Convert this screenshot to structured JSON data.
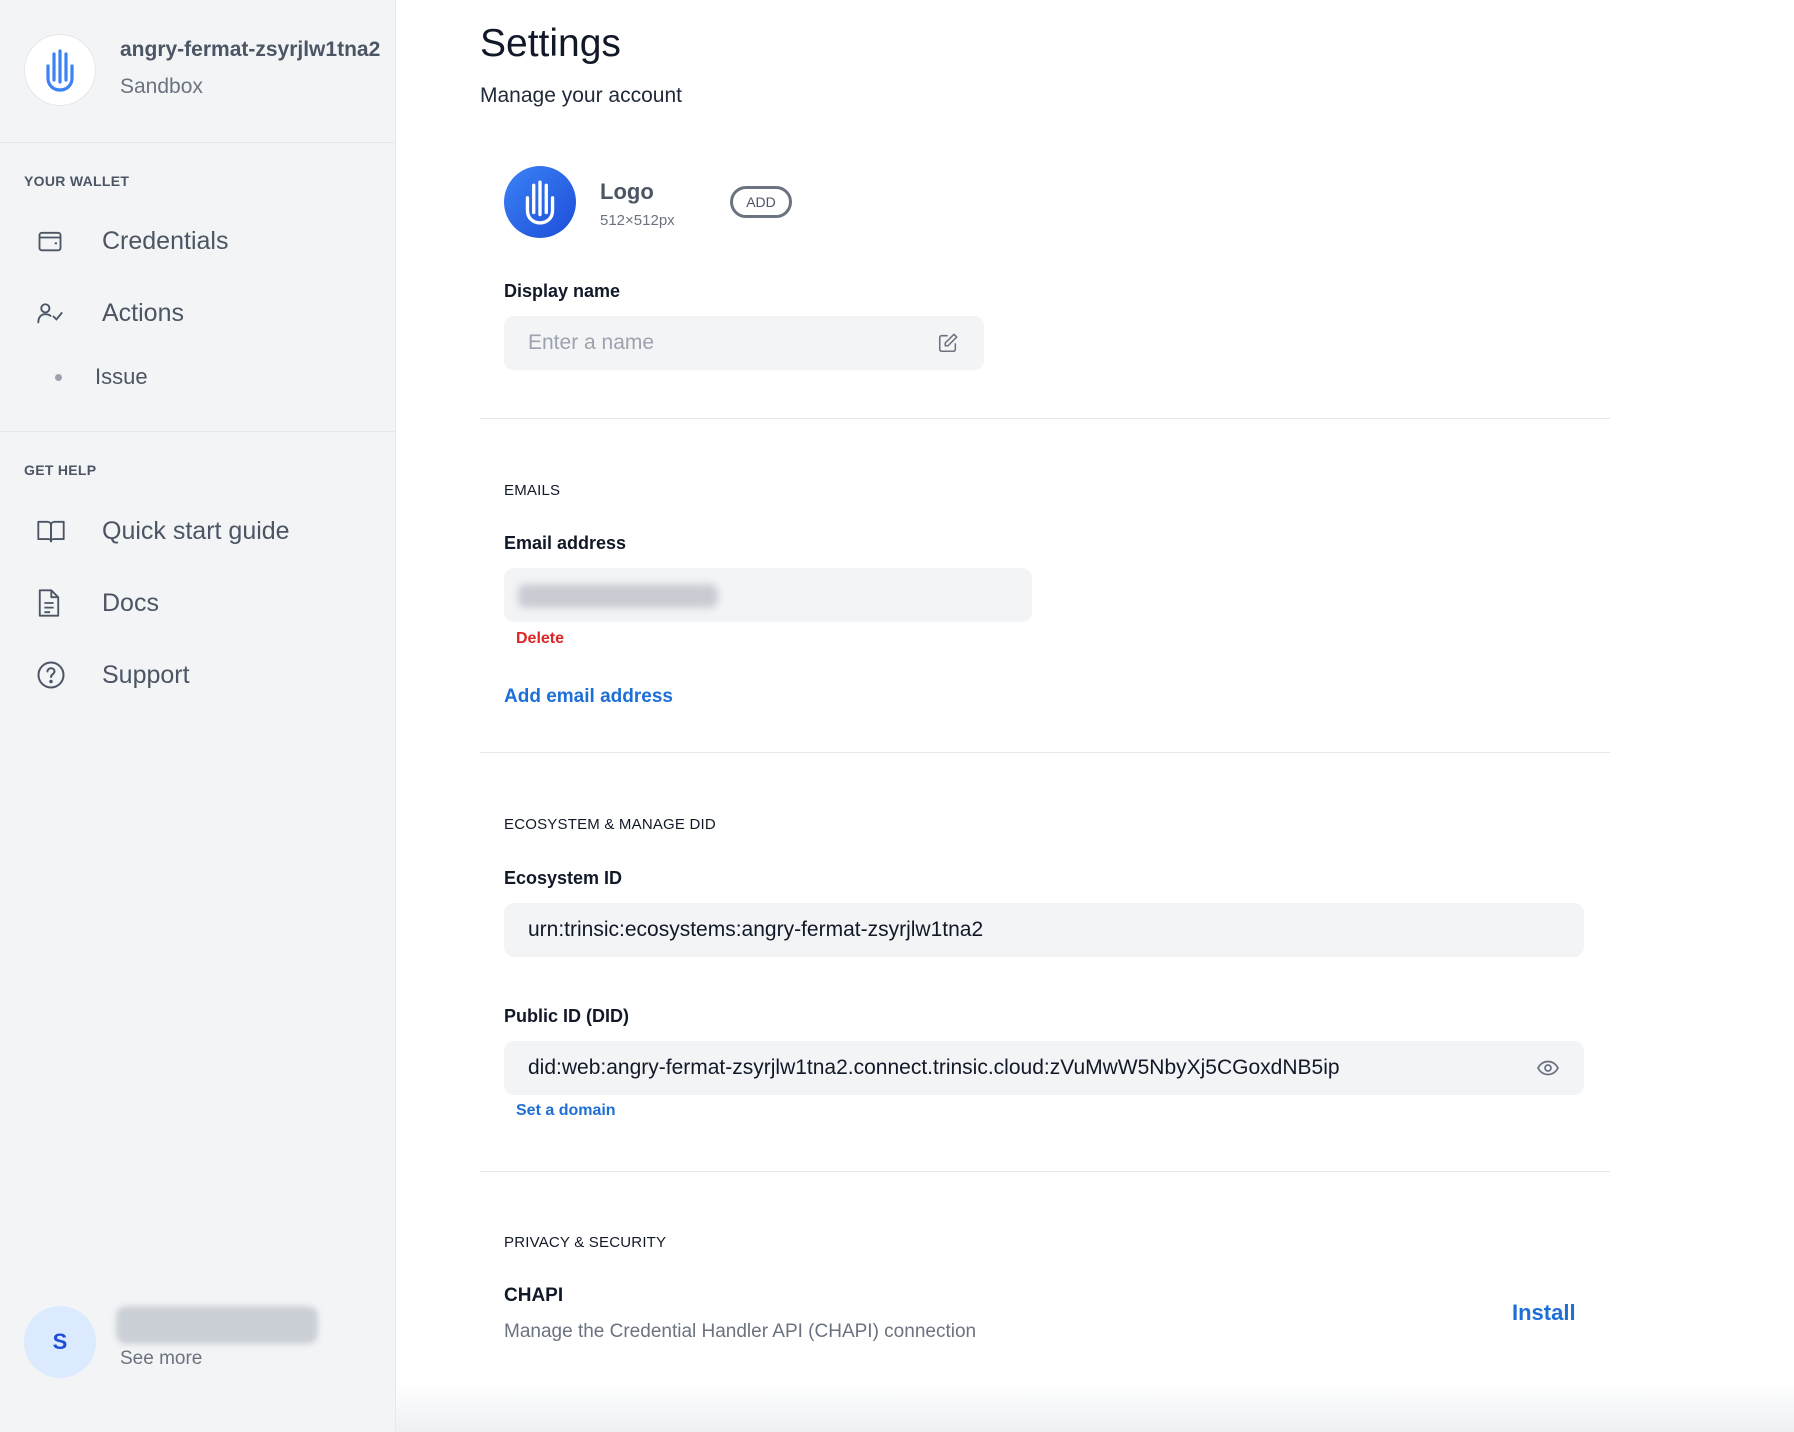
{
  "org": {
    "name": "angry-fermat-zsyrjlw1tna2",
    "environment": "Sandbox",
    "logo_icon": "trinsic-hand-icon"
  },
  "sidebar": {
    "wallet_label": "YOUR WALLET",
    "help_label": "GET HELP",
    "items": [
      {
        "label": "Credentials",
        "icon": "wallet-icon"
      },
      {
        "label": "Actions",
        "icon": "user-check-icon"
      },
      {
        "label": "Issue",
        "icon": "dot-icon"
      },
      {
        "label": "Quick start guide",
        "icon": "book-icon"
      },
      {
        "label": "Docs",
        "icon": "document-icon"
      },
      {
        "label": "Support",
        "icon": "question-circle-icon"
      }
    ]
  },
  "user": {
    "initial": "S",
    "see_more": "See more"
  },
  "page": {
    "title": "Settings",
    "subtitle": "Manage your account"
  },
  "logo": {
    "title": "Logo",
    "size": "512×512px",
    "add_label": "ADD"
  },
  "display_name": {
    "label": "Display name",
    "placeholder": "Enter a name"
  },
  "emails": {
    "section": "EMAILS",
    "label": "Email address",
    "delete_label": "Delete",
    "add_label": "Add email address"
  },
  "ecosystem": {
    "section": "ECOSYSTEM & MANAGE DID",
    "id_label": "Ecosystem ID",
    "id_value": "urn:trinsic:ecosystems:angry-fermat-zsyrjlw1tna2",
    "did_label": "Public ID (DID)",
    "did_value": "did:web:angry-fermat-zsyrjlw1tna2.connect.trinsic.cloud:zVuMwW5NbyXj5CGoxdNB5ip",
    "set_domain": "Set a domain"
  },
  "privacy": {
    "section": "PRIVACY & SECURITY",
    "chapi_title": "CHAPI",
    "chapi_desc": "Manage the Credential Handler API (CHAPI) connection",
    "install_label": "Install"
  },
  "colors": {
    "accent": "#1d6fd8",
    "danger": "#dc2626",
    "sidebar_bg": "#f3f4f6"
  }
}
